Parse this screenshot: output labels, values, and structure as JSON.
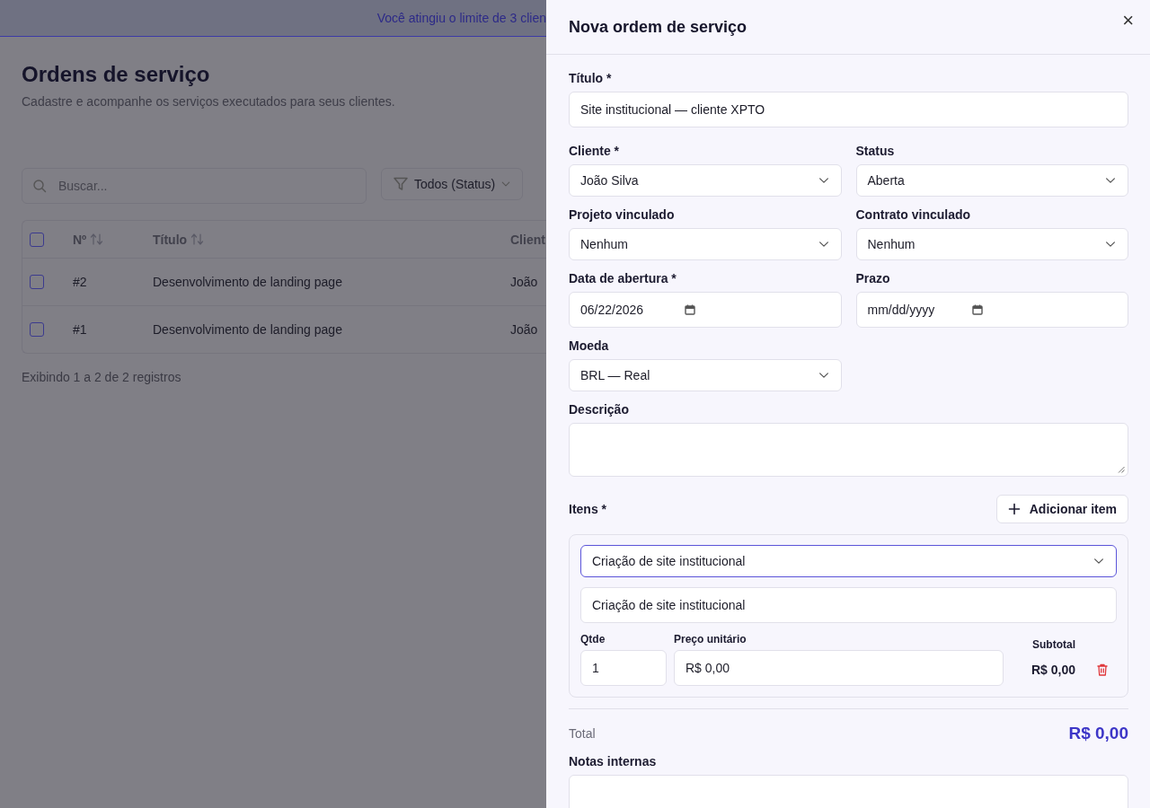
{
  "banner": {
    "text": "Você atingiu o limite de 3 clien"
  },
  "page": {
    "title": "Ordens de serviço",
    "subtitle": "Cadastre e acompanhe os serviços executados para seus clientes.",
    "search": {
      "placeholder": "Buscar..."
    },
    "filter": {
      "label": "Todos (Status)"
    },
    "table": {
      "header_checked": false,
      "columns": [
        {
          "label": "Nº",
          "sortable": true
        },
        {
          "label": "Título",
          "sortable": true
        },
        {
          "label": "Client",
          "sortable": false
        }
      ],
      "rows": [
        {
          "checked": false,
          "cells": [
            "#2",
            "Desenvolvimento de landing page",
            "João"
          ]
        },
        {
          "checked": false,
          "cells": [
            "#1",
            "Desenvolvimento de landing page",
            "João"
          ]
        }
      ]
    },
    "footer": "Exibindo 1 a 2 de 2 registros"
  },
  "drawer": {
    "title": "Nova ordem de serviço",
    "close": "×",
    "rows": [
      [
        {
          "kind": "text",
          "label": "Título *",
          "value": "Site institucional — cliente XPTO"
        }
      ],
      [
        {
          "kind": "select",
          "label": "Cliente *",
          "value": "João Silva"
        },
        {
          "kind": "select",
          "label": "Status",
          "value": "Aberta"
        }
      ],
      [
        {
          "kind": "select",
          "label": "Projeto vinculado",
          "value": "Nenhum"
        },
        {
          "kind": "select",
          "label": "Contrato vinculado",
          "value": "Nenhum"
        }
      ],
      [
        {
          "kind": "date",
          "label": "Data de abertura *",
          "value": "06/22/2026"
        },
        {
          "kind": "date",
          "label": "Prazo",
          "placeholder": "mm/dd/yyyy"
        }
      ],
      [
        {
          "kind": "select",
          "label": "Moeda",
          "value": "BRL — Real"
        }
      ],
      [
        {
          "kind": "textarea",
          "label": "Descrição"
        }
      ]
    ],
    "items_label": "Itens *",
    "add_button": "Adicionar item",
    "items": [
      {
        "product": "Criação de site institucional",
        "focused": true,
        "description": "Criação de site institucional",
        "qty_label": "Qtde",
        "qty": "1",
        "price_label": "Preço unitário",
        "price": "R$ 0,00",
        "subtotal_label": "Subtotal",
        "subtotal": "R$ 0,00"
      }
    ],
    "total_label": "Total",
    "total": "R$ 0,00",
    "notes_label": "Notas internas"
  }
}
